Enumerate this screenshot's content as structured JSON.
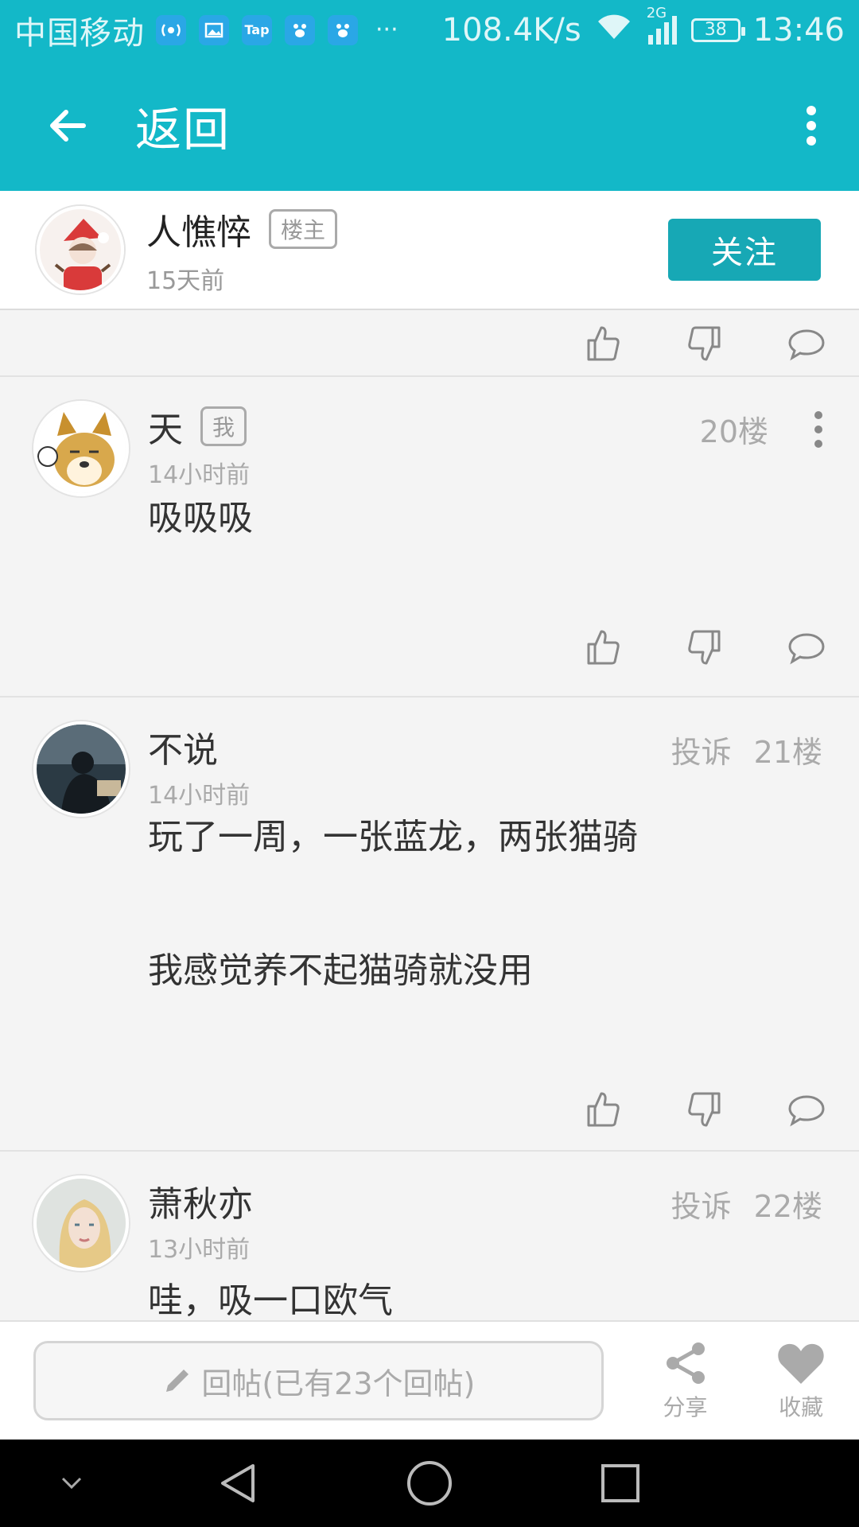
{
  "status_bar": {
    "carrier": "中国移动",
    "app_icons": [
      "signal-app-icon",
      "gallery-app-icon",
      "tap-app-icon",
      "baidu-app-icon",
      "baidu-app-icon"
    ],
    "tap_label": "Tap",
    "more": "···",
    "speed": "108.4K/s",
    "network": "2G",
    "battery": "38",
    "time": "13:46"
  },
  "toolbar": {
    "title": "返回"
  },
  "op": {
    "name": "人憔悴",
    "tag": "楼主",
    "time": "15天前",
    "follow_label": "关注"
  },
  "posts": [
    {
      "name": "天",
      "tag": "我",
      "time": "14小时前",
      "floor": "20楼",
      "lines": [
        "吸吸吸"
      ]
    },
    {
      "name": "不说",
      "report": "投诉",
      "time": "14小时前",
      "floor": "21楼",
      "lines": [
        "玩了一周，一张蓝龙，两张猫骑",
        "",
        "我感觉养不起猫骑就没用"
      ]
    },
    {
      "name": "萧秋亦",
      "report": "投诉",
      "time": "13小时前",
      "floor": "22楼",
      "lines": [
        "哇，吸一口欧气"
      ]
    }
  ],
  "reply_bar": {
    "placeholder": "回帖(已有23个回帖)",
    "share_label": "分享",
    "favorite_label": "收藏"
  },
  "colors": {
    "primary": "#13b8c8",
    "button": "#17a8b5"
  }
}
